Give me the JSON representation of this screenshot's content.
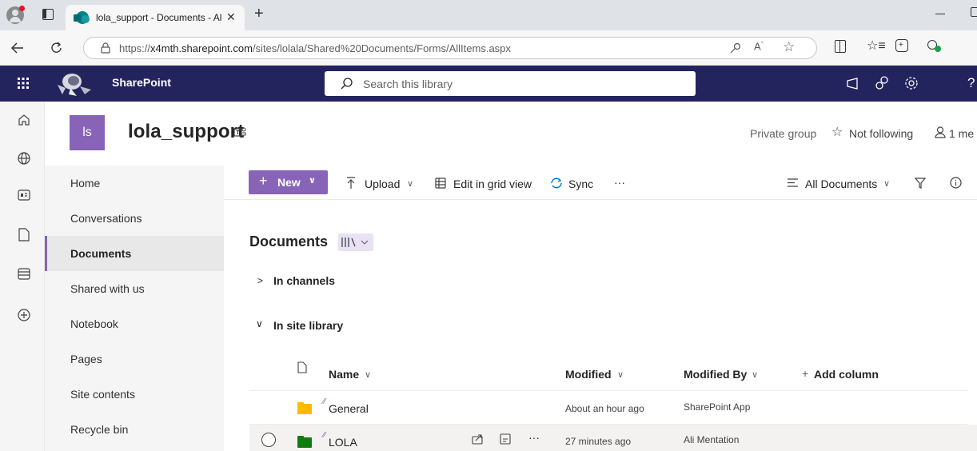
{
  "browser": {
    "tab_title": "lola_support - Documents - All Do",
    "url_prefix": "https://",
    "url_host": "x4mth.sharepoint.com",
    "url_path": "/sites/lolala/Shared%20Documents/Forms/AllItems.aspx"
  },
  "suite": {
    "brand": "SharePoint",
    "search_placeholder": "Search this library"
  },
  "site": {
    "initials": "ls",
    "title": "lola_support",
    "privacy": "Private group",
    "follow": "Not following",
    "members": "1 me"
  },
  "nav": {
    "items": [
      {
        "label": "Home"
      },
      {
        "label": "Conversations"
      },
      {
        "label": "Documents"
      },
      {
        "label": "Shared with us"
      },
      {
        "label": "Notebook"
      },
      {
        "label": "Pages"
      },
      {
        "label": "Site contents"
      },
      {
        "label": "Recycle bin"
      }
    ],
    "active": "Documents"
  },
  "commands": {
    "new": "New",
    "upload": "Upload",
    "edit_grid": "Edit in grid view",
    "sync": "Sync",
    "more": "···",
    "view": "All Documents"
  },
  "library": {
    "title": "Documents",
    "group_channels": "In channels",
    "group_site": "In site library",
    "columns": {
      "name": "Name",
      "modified": "Modified",
      "modified_by": "Modified By",
      "add_column": "Add column"
    },
    "rows": [
      {
        "name": "General",
        "modified": "About an hour ago",
        "modified_by": "SharePoint App",
        "folder_color": "#ffb900"
      },
      {
        "name": "LOLA",
        "modified": "27 minutes ago",
        "modified_by": "Ali Mentation",
        "folder_color": "#107c10",
        "more": "···"
      }
    ]
  },
  "colors": {
    "accent": "#8764b8",
    "suite_bar": "#23235e"
  }
}
